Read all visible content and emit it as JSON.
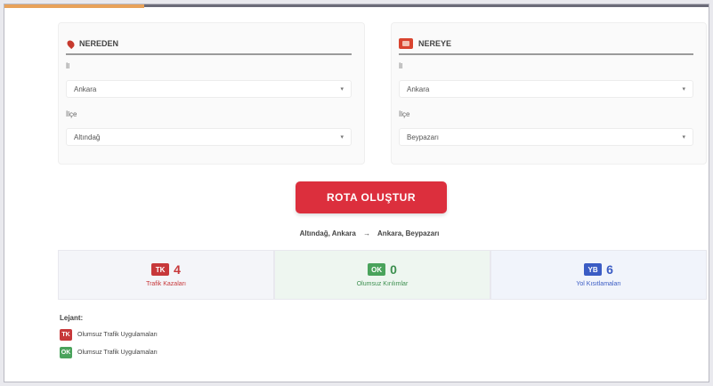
{
  "origin_card": {
    "title": "NEREDEN",
    "il_label": "İl",
    "il_value": "Ankara",
    "ilce_label": "İlçe",
    "ilce_value": "Altındağ"
  },
  "destination_card": {
    "title": "NEREYE",
    "il_label": "İl",
    "il_value": "Ankara",
    "ilce_label": "İlçe",
    "ilce_value": "Beypazarı"
  },
  "create_button_label": "ROTA OLUŞTUR",
  "route_summary": {
    "from": "Altındağ, Ankara",
    "arrow": "→",
    "to": "Ankara, Beypazarı"
  },
  "stats": [
    {
      "badge": "TK",
      "value": "4",
      "label": "Trafik Kazaları",
      "color": "#c7383a"
    },
    {
      "badge": "OK",
      "value": "0",
      "label": "Olumsuz Kırılımlar",
      "color": "#4aa35c"
    },
    {
      "badge": "YB",
      "value": "6",
      "label": "Yol Kısıtlamaları",
      "color": "#3b5cc4"
    }
  ],
  "legend": {
    "title": "Lejant:",
    "items": [
      {
        "badge": "TK",
        "label": "Olumsuz Trafik Uygulamaları",
        "color": "#c7383a"
      },
      {
        "badge": "OK",
        "label": "Olumsuz Trafik Uygulamaları",
        "color": "#4aa35c"
      }
    ]
  },
  "icons": {
    "origin": "map-pin-icon",
    "destination": "flag-icon",
    "select_arrow": "chevron-down-icon"
  }
}
